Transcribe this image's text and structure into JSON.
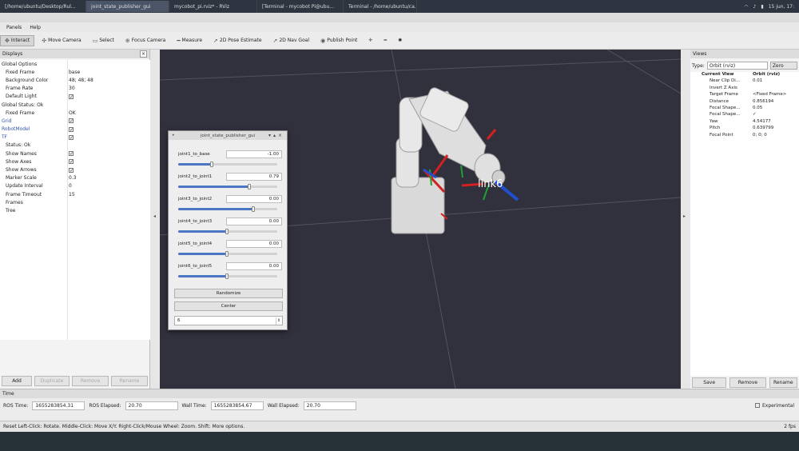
{
  "taskbar": {
    "tasks": [
      "[/home/ubuntu/Desktop/Rul...",
      "joint_state_publisher_gui",
      "mycobot_pi.rviz* - RViz",
      "[Terminal - mycobot Pi@ubu...",
      "Terminal - /home/ubuntu/ca..."
    ],
    "active_index": 1,
    "clock": "15 jun, 17:"
  },
  "menubar": {
    "items": [
      "Panels",
      "Help"
    ]
  },
  "toolbar": {
    "tools": [
      {
        "label": "Interact",
        "icon": "interact-icon",
        "active": true
      },
      {
        "label": "Move Camera",
        "icon": "move-camera-icon",
        "active": false
      },
      {
        "label": "Select",
        "icon": "select-icon",
        "active": false
      },
      {
        "label": "Focus Camera",
        "icon": "focus-camera-icon",
        "active": false
      },
      {
        "label": "Measure",
        "icon": "measure-icon",
        "active": false
      },
      {
        "label": "2D Pose Estimate",
        "icon": "pose-estimate-icon",
        "active": false
      },
      {
        "label": "2D Nav Goal",
        "icon": "nav-goal-icon",
        "active": false
      },
      {
        "label": "Publish Point",
        "icon": "publish-point-icon",
        "active": false
      }
    ]
  },
  "displays": {
    "title": "Displays",
    "rows": [
      {
        "key": "Global Options",
        "value": "",
        "indent": 1,
        "blue": false,
        "check": false
      },
      {
        "key": "Fixed Frame",
        "value": "base",
        "indent": 2,
        "blue": false,
        "check": false
      },
      {
        "key": "Background Color",
        "value": "48; 48; 48",
        "indent": 2,
        "blue": false,
        "check": false
      },
      {
        "key": "Frame Rate",
        "value": "30",
        "indent": 2,
        "blue": false,
        "check": false
      },
      {
        "key": "Default Light",
        "value": "✓",
        "indent": 2,
        "blue": false,
        "check": true
      },
      {
        "key": "Global Status: Ok",
        "value": "",
        "indent": 1,
        "blue": false,
        "check": false
      },
      {
        "key": "Fixed Frame",
        "value": "OK",
        "indent": 2,
        "blue": false,
        "check": false
      },
      {
        "key": "Grid",
        "value": "✓",
        "indent": 1,
        "blue": true,
        "check": true
      },
      {
        "key": "RobotModel",
        "value": "✓",
        "indent": 1,
        "blue": true,
        "check": true
      },
      {
        "key": "TF",
        "value": "✓",
        "indent": 1,
        "blue": true,
        "check": true
      },
      {
        "key": "Status: Ok",
        "value": "",
        "indent": 2,
        "blue": false,
        "check": false
      },
      {
        "key": "Show Names",
        "value": "✓",
        "indent": 2,
        "blue": false,
        "check": true
      },
      {
        "key": "Show Axes",
        "value": "✓",
        "indent": 2,
        "blue": false,
        "check": true
      },
      {
        "key": "Show Arrows",
        "value": "✓",
        "indent": 2,
        "blue": false,
        "check": true
      },
      {
        "key": "Marker Scale",
        "value": "0.3",
        "indent": 2,
        "blue": false,
        "check": false
      },
      {
        "key": "Update Interval",
        "value": "0",
        "indent": 2,
        "blue": false,
        "check": false
      },
      {
        "key": "Frame Timeout",
        "value": "15",
        "indent": 2,
        "blue": false,
        "check": false
      },
      {
        "key": "Frames",
        "value": "",
        "indent": 2,
        "blue": false,
        "check": false
      },
      {
        "key": "Tree",
        "value": "",
        "indent": 2,
        "blue": false,
        "check": false
      }
    ],
    "buttons": [
      "Add",
      "Duplicate",
      "Remove",
      "Rename"
    ]
  },
  "views": {
    "title": "Views",
    "type_label": "Type:",
    "type_value": "Orbit (rviz)",
    "zero_button": "Zero",
    "rows": [
      {
        "key": "Current View",
        "value": "Orbit (rviz)",
        "bold": true
      },
      {
        "key": "Near Clip Di...",
        "value": "0.01",
        "bold": false
      },
      {
        "key": "Invert Z Axis",
        "value": "",
        "bold": false
      },
      {
        "key": "Target Frame",
        "value": "<Fixed Frame>",
        "bold": false
      },
      {
        "key": "Distance",
        "value": "0.856194",
        "bold": false
      },
      {
        "key": "Focal Shape...",
        "value": "0.05",
        "bold": false
      },
      {
        "key": "Focal Shape...",
        "value": "✓",
        "bold": false
      },
      {
        "key": "Yaw",
        "value": "4.54177",
        "bold": false
      },
      {
        "key": "Pitch",
        "value": "0.639799",
        "bold": false
      },
      {
        "key": "Focal Point",
        "value": "0; 0; 0",
        "bold": false
      }
    ],
    "buttons": [
      "Save",
      "Remove",
      "Rename"
    ]
  },
  "time": {
    "title": "Time",
    "ros_time_label": "ROS Time:",
    "ros_time": "1655283854.31",
    "ros_elapsed_label": "ROS Elapsed:",
    "ros_elapsed": "20.70",
    "wall_time_label": "Wall Time:",
    "wall_time": "1655283854.67",
    "wall_elapsed_label": "Wall Elapsed:",
    "wall_elapsed": "20.70",
    "experimental_label": "Experimental"
  },
  "status": {
    "text": "Reset  Left-Click: Rotate. Middle-Click: Move X/Y. Right-Click/Mouse Wheel: Zoom. Shift: More options.",
    "fps": "2 fps"
  },
  "jsp": {
    "title": "joint_state_publisher_gui",
    "joints": [
      {
        "name": "joint1_to_base",
        "value": "-1.00",
        "fraction": 0.34
      },
      {
        "name": "joint2_to_joint1",
        "value": "0.79",
        "fraction": 0.72
      },
      {
        "name": "joint3_to_joint2",
        "value": "0.00",
        "fraction": 0.76
      },
      {
        "name": "joint4_to_joint3",
        "value": "0.00",
        "fraction": 0.49
      },
      {
        "name": "joint5_to_joint4",
        "value": "0.00",
        "fraction": 0.49
      },
      {
        "name": "joint6_to_joint5",
        "value": "0.00",
        "fraction": 0.49
      }
    ],
    "randomize": "Randomize",
    "center": "Center",
    "spin_value": "6"
  },
  "viewport": {
    "label": "link6",
    "background": "#31303d"
  }
}
